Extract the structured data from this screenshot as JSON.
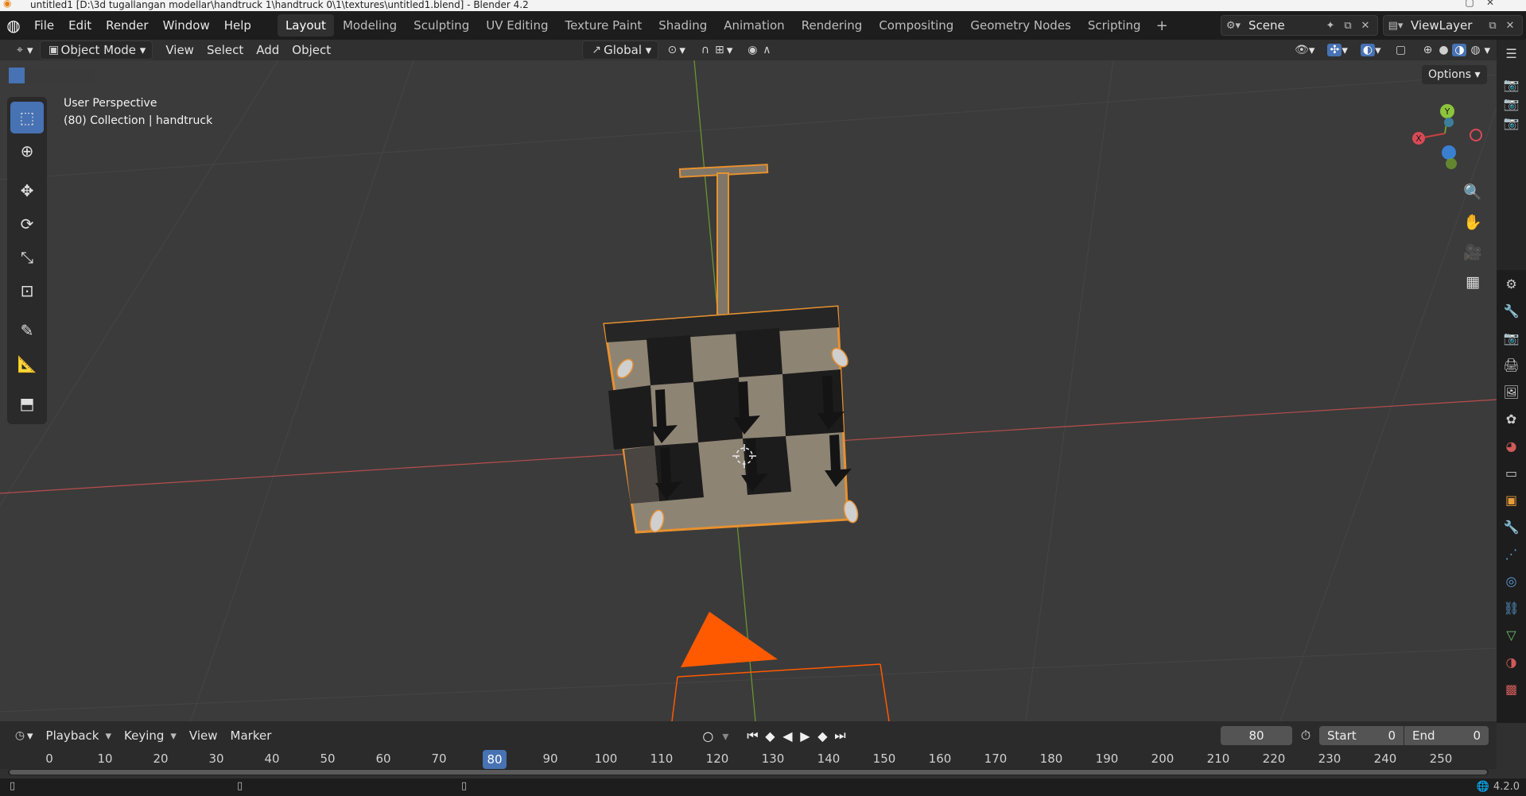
{
  "window": {
    "title": "untitled1 [D:\\3d tugallangan modellar\\handtruck 1\\handtruck 0\\1\\textures\\untitled1.blend] - Blender 4.2"
  },
  "menu": [
    "File",
    "Edit",
    "Render",
    "Window",
    "Help"
  ],
  "workspaces": [
    {
      "label": "Layout",
      "active": true
    },
    {
      "label": "Modeling"
    },
    {
      "label": "Sculpting"
    },
    {
      "label": "UV Editing"
    },
    {
      "label": "Texture Paint"
    },
    {
      "label": "Shading"
    },
    {
      "label": "Animation"
    },
    {
      "label": "Rendering"
    },
    {
      "label": "Compositing"
    },
    {
      "label": "Geometry Nodes"
    },
    {
      "label": "Scripting"
    }
  ],
  "scene": {
    "name": "Scene",
    "view_layer": "ViewLayer"
  },
  "header": {
    "mode": "Object Mode",
    "menus": [
      "View",
      "Select",
      "Add",
      "Object"
    ],
    "orientation": "Global",
    "options": "Options"
  },
  "viewport": {
    "perspective": "User Perspective",
    "info": "(80) Collection | handtruck",
    "colors": {
      "x_axis": "#b84d4d",
      "y_axis": "#6e9a2e",
      "selection": "#e8912f",
      "camera": "#ff5a00"
    }
  },
  "gizmo": {
    "x": "X",
    "y": "Y"
  },
  "timeline": {
    "menus": [
      "Playback",
      "Keying",
      "View",
      "Marker"
    ],
    "current_frame": "80",
    "start_label": "Start",
    "start": "0",
    "end_label": "End",
    "end": "0",
    "ticks": [
      "0",
      "10",
      "20",
      "30",
      "40",
      "50",
      "60",
      "70",
      "80",
      "90",
      "100",
      "110",
      "120",
      "130",
      "140",
      "150",
      "160",
      "170",
      "180",
      "190",
      "200",
      "210",
      "220",
      "230",
      "240",
      "250"
    ]
  },
  "status": {
    "version": "4.2.0"
  }
}
